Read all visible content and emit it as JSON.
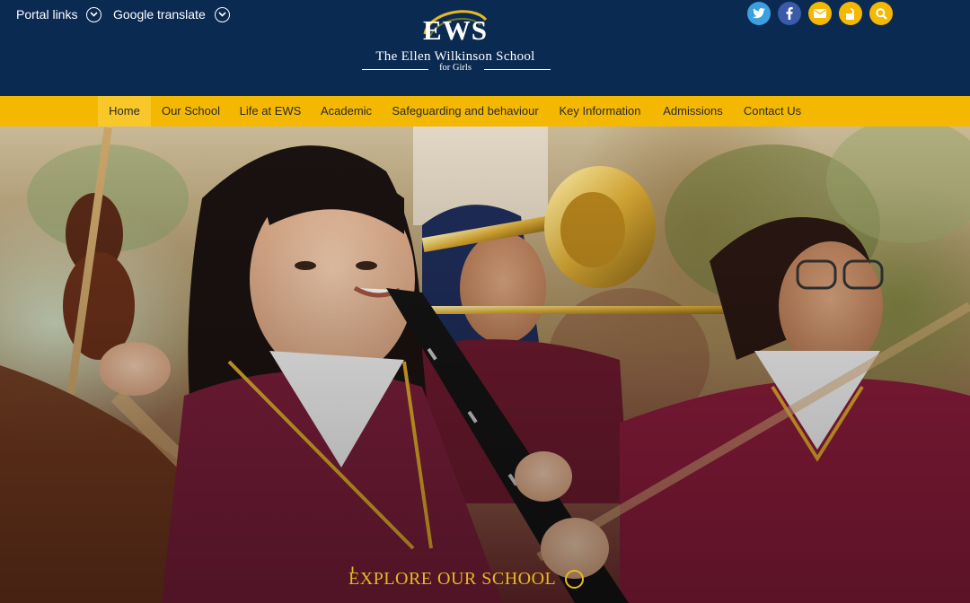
{
  "header": {
    "portal_links": "Portal links",
    "google_translate": "Google translate",
    "logo": {
      "mark": "EWS",
      "line1": "The Ellen Wilkinson School",
      "line2": "for Girls"
    },
    "social": [
      {
        "icon": "twitter-icon",
        "color": "#3aa0e0"
      },
      {
        "icon": "facebook-icon",
        "color": "#3b5aa8"
      },
      {
        "icon": "email-icon",
        "color": "#f5b800"
      },
      {
        "icon": "lock-icon",
        "color": "#f5b800"
      },
      {
        "icon": "search-icon",
        "color": "#f5b800"
      }
    ]
  },
  "nav": {
    "items": [
      "Home",
      "Our School",
      "Life at EWS",
      "Academic",
      "Safeguarding and behaviour",
      "Key Information",
      "Admissions",
      "Contact Us"
    ],
    "active": "Home"
  },
  "hero": {
    "cta": "EXPLORE OUR SCHOOL",
    "cta_icon": "chevron-down-circle-icon"
  },
  "colors": {
    "navy": "#0b2a52",
    "gold": "#f5b800",
    "maroon": "#7a1e3a"
  }
}
